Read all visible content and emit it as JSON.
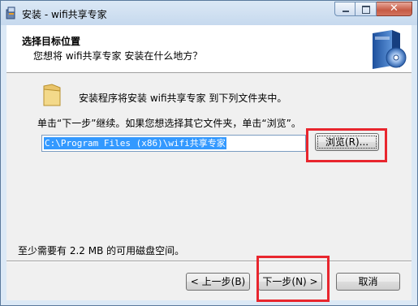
{
  "window": {
    "title": "安装 - wifi共享专家"
  },
  "header": {
    "title": "选择目标位置",
    "subtitle": "您想将 wifi共享专家 安装在什么地方？"
  },
  "body": {
    "install_message": "安装程序将安装 wifi共享专家 到下列文件夹中。",
    "instruction": "单击“下一步”继续。如果您想选择其它文件夹，单击“浏览”。",
    "path_value": "C:\\Program Files (x86)\\wifi共享专家",
    "browse_label": "浏览(R)...",
    "disk_space": "至少需要有 2.2 MB 的可用磁盘空间。"
  },
  "footer": {
    "back_label": "< 上一步(B)",
    "next_label": "下一步(N) >",
    "cancel_label": "取消"
  },
  "colors": {
    "highlight": "#e8262e",
    "selection": "#3399ff"
  }
}
